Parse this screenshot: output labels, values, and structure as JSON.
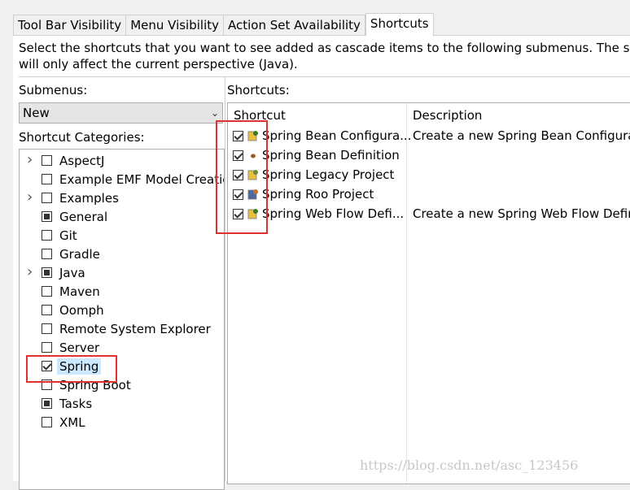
{
  "tabs": [
    "Tool Bar Visibility",
    "Menu Visibility",
    "Action Set Availability",
    "Shortcuts"
  ],
  "active_tab": "Shortcuts",
  "description_line1": "Select the shortcuts that you want to see added as cascade items to the following submenus.  The selec",
  "description_line2": "will only affect the current perspective (Java).",
  "submenus_label": "Submenus:",
  "submenus_value": "New",
  "categories_label": "Shortcut Categories:",
  "shortcuts_label": "Shortcuts:",
  "categories": [
    {
      "label": "AspectJ",
      "state": "unchecked",
      "expandable": true
    },
    {
      "label": "Example EMF Model Creation Wizards",
      "state": "unchecked",
      "expandable": false
    },
    {
      "label": "Examples",
      "state": "unchecked",
      "expandable": true
    },
    {
      "label": "General",
      "state": "partial",
      "expandable": false
    },
    {
      "label": "Git",
      "state": "unchecked",
      "expandable": false
    },
    {
      "label": "Gradle",
      "state": "unchecked",
      "expandable": false
    },
    {
      "label": "Java",
      "state": "partial",
      "expandable": true
    },
    {
      "label": "Maven",
      "state": "unchecked",
      "expandable": false
    },
    {
      "label": "Oomph",
      "state": "unchecked",
      "expandable": false
    },
    {
      "label": "Remote System Explorer",
      "state": "unchecked",
      "expandable": false
    },
    {
      "label": "Server",
      "state": "unchecked",
      "expandable": false
    },
    {
      "label": "Spring",
      "state": "checked",
      "expandable": false,
      "selected": true
    },
    {
      "label": "Spring Boot",
      "state": "unchecked",
      "expandable": false
    },
    {
      "label": "Tasks",
      "state": "partial",
      "expandable": false
    },
    {
      "label": "XML",
      "state": "unchecked",
      "expandable": false
    }
  ],
  "shortcut_columns": {
    "shortcut": "Shortcut",
    "description": "Description"
  },
  "shortcuts": [
    {
      "name": "Spring Bean Configura...",
      "description": "Create a new Spring Bean Configurati",
      "checked": true,
      "icon": "spring-bean-config-icon"
    },
    {
      "name": "Spring Bean Definition",
      "description": "",
      "checked": true,
      "icon": "spring-bean-icon"
    },
    {
      "name": "Spring Legacy Project",
      "description": "",
      "checked": true,
      "icon": "spring-project-icon"
    },
    {
      "name": "Spring Roo Project",
      "description": "",
      "checked": true,
      "icon": "spring-roo-icon"
    },
    {
      "name": "Spring Web Flow Defi...",
      "description": "Create a new Spring Web Flow Defini",
      "checked": true,
      "icon": "spring-webflow-icon"
    }
  ],
  "watermark": "https://blog.csdn.net/asc_123456",
  "colors": {
    "highlight": "#e03030",
    "selection": "#cce8ff"
  }
}
